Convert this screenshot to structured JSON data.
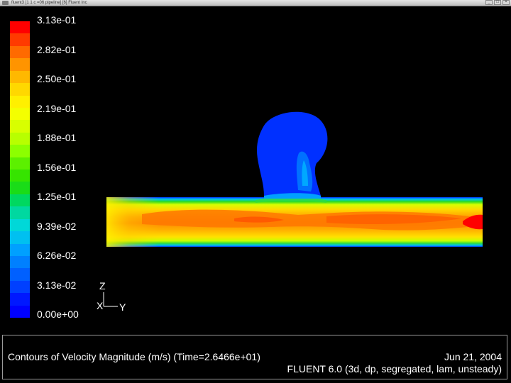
{
  "window": {
    "title": "fluent3 [1 1 c =06 pipeline] [6] Fluent Inc",
    "buttons": [
      "_",
      "□",
      "×"
    ]
  },
  "legend": {
    "labels": [
      "3.13e-01",
      "2.82e-01",
      "2.50e-01",
      "2.19e-01",
      "1.88e-01",
      "1.56e-01",
      "1.25e-01",
      "9.39e-02",
      "6.26e-02",
      "3.13e-02",
      "0.00e+00"
    ],
    "colors": [
      "#ff0000",
      "#ff3a00",
      "#ff6a00",
      "#ff9400",
      "#ffb800",
      "#ffd800",
      "#fff000",
      "#f4ff00",
      "#d8ff00",
      "#b8ff00",
      "#8cff00",
      "#5cf000",
      "#36e400",
      "#1adc18",
      "#00d860",
      "#00d8a0",
      "#00d8d8",
      "#00c0f0",
      "#00a0ff",
      "#0080ff",
      "#0060ff",
      "#0040ff",
      "#0018ff",
      "#0000ff"
    ]
  },
  "axes": {
    "z": "Z",
    "x": "X",
    "y": "Y"
  },
  "caption": {
    "title": "Contours of Velocity Magnitude (m/s)  (Time=2.6466e+01)",
    "date": "Jun 21, 2004",
    "solver": "FLUENT 6.0 (3d, dp, segregated, lam, unsteady)"
  }
}
